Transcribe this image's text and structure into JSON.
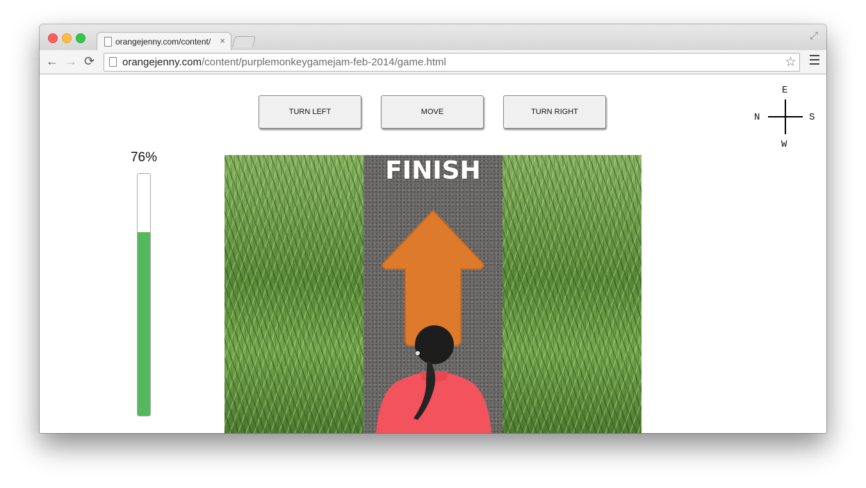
{
  "browser": {
    "tab_title": "orangejenny.com/content/",
    "tab_close": "×",
    "url_host": "orangejenny.com",
    "url_path": "/content/purplemonkeygamejam-feb-2014/game.html",
    "star_icon": "star-icon",
    "menu_icon": "menu-icon"
  },
  "game": {
    "buttons": {
      "turn_left": "TURN LEFT",
      "move": "MOVE",
      "turn_right": "TURN RIGHT"
    },
    "compass": {
      "top": "E",
      "bottom": "W",
      "left": "N",
      "right": "S"
    },
    "progress": {
      "label": "76%",
      "value": 0.76,
      "fill_color": "#55b85c"
    },
    "scene": {
      "banner": "FINISH",
      "arrow_color": "#de7a2c",
      "runner_shirt_color": "#f2535c"
    }
  }
}
